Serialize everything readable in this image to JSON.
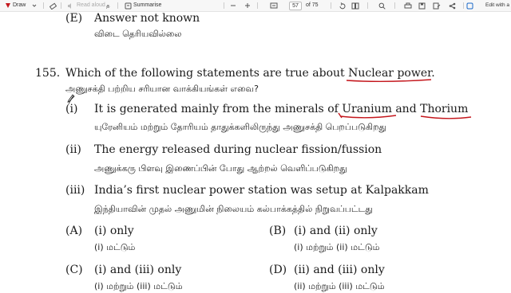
{
  "toolbar": {
    "draw_label": "Draw",
    "read_aloud_label": "Read aloud",
    "tamil_char": "த",
    "summarise_label": "Summarise",
    "page_current": "57",
    "page_total": "of 75",
    "edit_label": "Edit with a"
  },
  "prev_question": {
    "option_e_label": "(E)",
    "option_e_en": "Answer not known",
    "option_e_ta": "விடை தெரியவில்லை"
  },
  "question": {
    "number": "155.",
    "text_en": "Which of the following statements are true about Nuclear power.",
    "text_ta": "அணுசக்தி பற்றிய சரியான வாக்கியங்கள் எவை?",
    "statements": [
      {
        "num": "(i)",
        "en": "It is generated mainly from the minerals of Uranium and Thorium",
        "ta": "யுரேனியம் மற்றும் தோரியம் தாதுக்களிலிருந்து அணுசக்தி பெறப்படுகிறது"
      },
      {
        "num": "(ii)",
        "en": "The energy released during nuclear fission/fussion",
        "ta": "அணுக்கரு பிளவு இணைப்பின் போது ஆற்றல் வெளிப்படுகிறது"
      },
      {
        "num": "(iii)",
        "en": "India’s first nuclear power station was setup at Kalpakkam",
        "ta": "இந்தியாவின் முதல் அணுமின் நிலையம் கல்பாக்கத்தில் நிறுவப்பட்டது"
      }
    ],
    "options": [
      {
        "label": "(A)",
        "en": "(i) only",
        "ta": "(i) மட்டும்"
      },
      {
        "label": "(B)",
        "en": "(i) and (ii) only",
        "ta": "(i) மற்றும் (ii) மட்டும்"
      },
      {
        "label": "(C)",
        "en": "(i) and (iii) only",
        "ta": "(i) மற்றும் (iii) மட்டும்"
      },
      {
        "label": "(D)",
        "en": "(ii) and (iii) only",
        "ta": "(ii) மற்றும் (iii) மட்டும்"
      }
    ]
  },
  "colors": {
    "ink_red": "#c4161c",
    "text": "#1a1a1a",
    "toolbar_bg": "#f7f7f7"
  }
}
